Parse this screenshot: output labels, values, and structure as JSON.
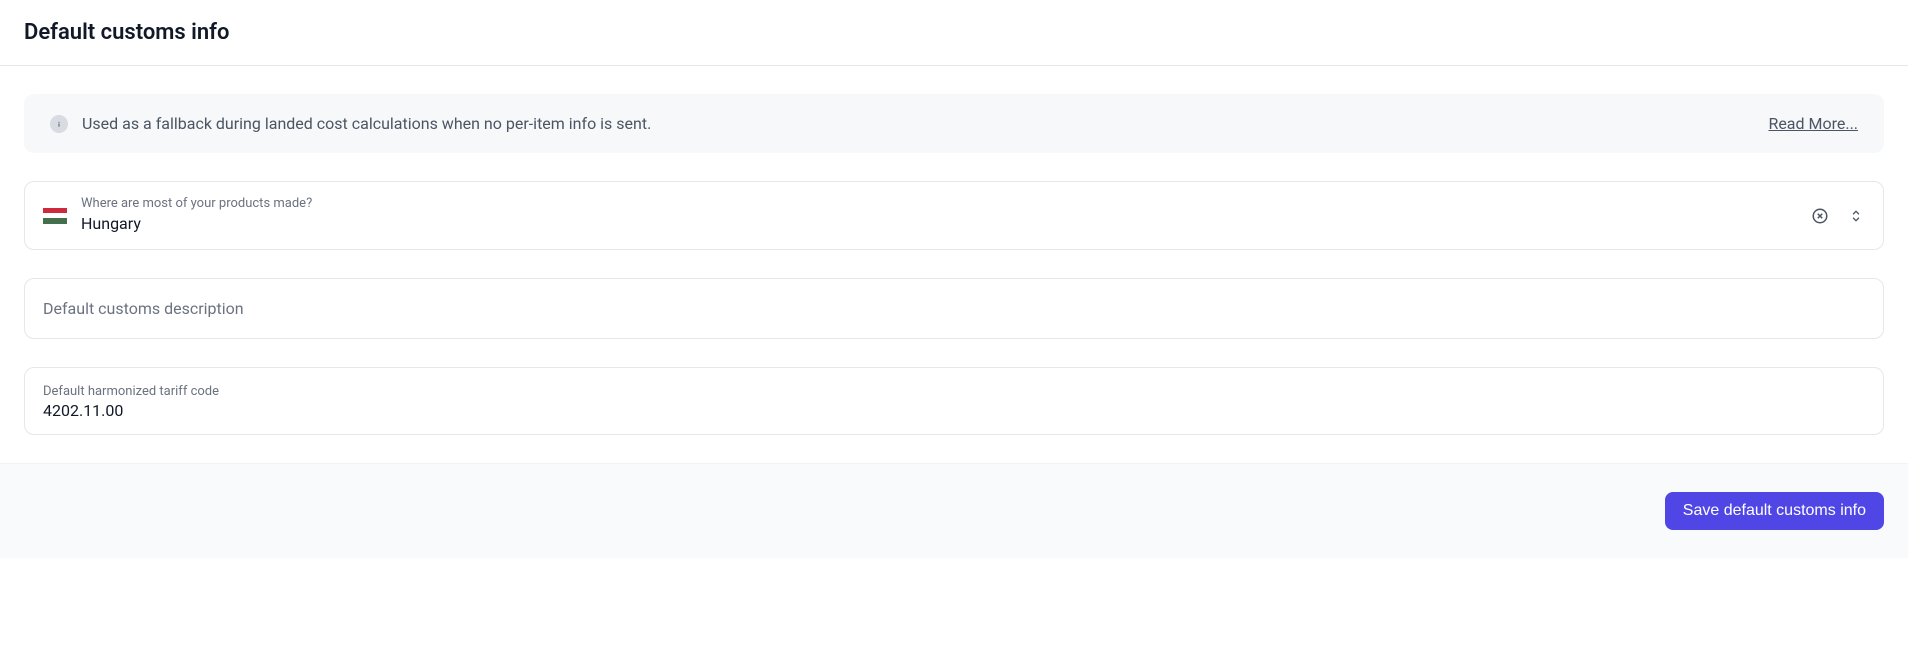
{
  "header": {
    "title": "Default customs info"
  },
  "banner": {
    "text": "Used as a fallback during landed cost calculations when no per-item info is sent.",
    "read_more": "Read More..."
  },
  "fields": {
    "origin": {
      "label": "Where are most of your products made?",
      "value": "Hungary"
    },
    "description": {
      "placeholder": "Default customs description"
    },
    "tariff": {
      "label": "Default harmonized tariff code",
      "value": "4202.11.00"
    }
  },
  "footer": {
    "save_label": "Save default customs info"
  }
}
